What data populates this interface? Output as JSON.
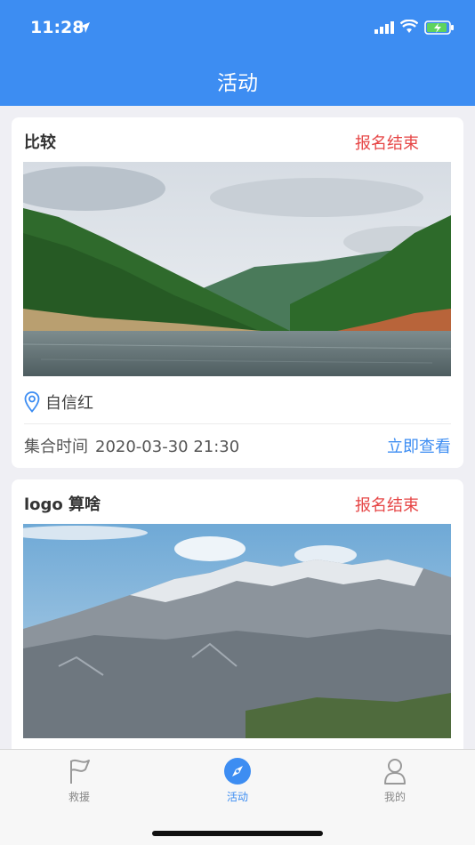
{
  "status_bar": {
    "time": "11:28"
  },
  "nav": {
    "title": "活动"
  },
  "cards": [
    {
      "title": "比较",
      "status": "报名结束",
      "image_alt": "lake-mountain-photo",
      "location": "自信红",
      "time_label": "集合时间",
      "time_value": "2020-03-30 21:30",
      "action": "立即查看"
    },
    {
      "title": "logo 算啥",
      "status": "报名结束",
      "image_alt": "snow-mountain-photo"
    }
  ],
  "tabbar": {
    "items": [
      {
        "label": "救援",
        "icon": "flag-icon"
      },
      {
        "label": "活动",
        "icon": "compass-icon",
        "active": true
      },
      {
        "label": "我的",
        "icon": "user-icon"
      }
    ]
  },
  "colors": {
    "accent": "#3d8df2",
    "status_red": "#e64545"
  }
}
